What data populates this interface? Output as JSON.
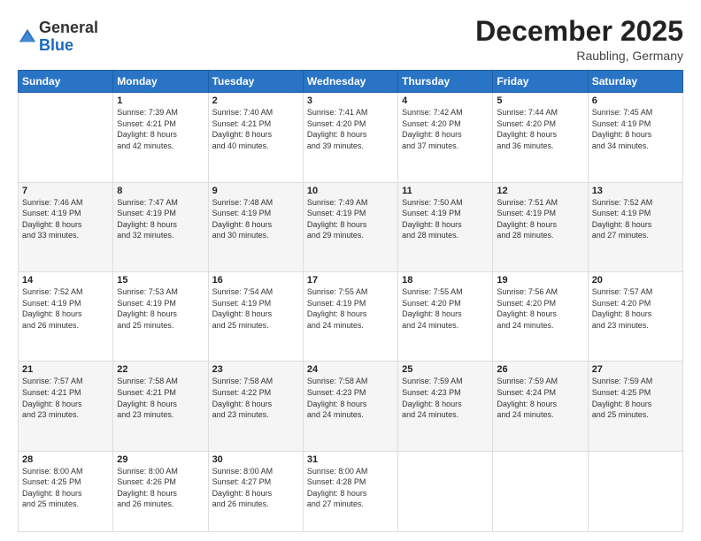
{
  "header": {
    "logo_general": "General",
    "logo_blue": "Blue",
    "month_title": "December 2025",
    "location": "Raubling, Germany"
  },
  "days_of_week": [
    "Sunday",
    "Monday",
    "Tuesday",
    "Wednesday",
    "Thursday",
    "Friday",
    "Saturday"
  ],
  "weeks": [
    [
      {
        "day": "",
        "text": ""
      },
      {
        "day": "1",
        "text": "Sunrise: 7:39 AM\nSunset: 4:21 PM\nDaylight: 8 hours\nand 42 minutes."
      },
      {
        "day": "2",
        "text": "Sunrise: 7:40 AM\nSunset: 4:21 PM\nDaylight: 8 hours\nand 40 minutes."
      },
      {
        "day": "3",
        "text": "Sunrise: 7:41 AM\nSunset: 4:20 PM\nDaylight: 8 hours\nand 39 minutes."
      },
      {
        "day": "4",
        "text": "Sunrise: 7:42 AM\nSunset: 4:20 PM\nDaylight: 8 hours\nand 37 minutes."
      },
      {
        "day": "5",
        "text": "Sunrise: 7:44 AM\nSunset: 4:20 PM\nDaylight: 8 hours\nand 36 minutes."
      },
      {
        "day": "6",
        "text": "Sunrise: 7:45 AM\nSunset: 4:19 PM\nDaylight: 8 hours\nand 34 minutes."
      }
    ],
    [
      {
        "day": "7",
        "text": "Sunrise: 7:46 AM\nSunset: 4:19 PM\nDaylight: 8 hours\nand 33 minutes."
      },
      {
        "day": "8",
        "text": "Sunrise: 7:47 AM\nSunset: 4:19 PM\nDaylight: 8 hours\nand 32 minutes."
      },
      {
        "day": "9",
        "text": "Sunrise: 7:48 AM\nSunset: 4:19 PM\nDaylight: 8 hours\nand 30 minutes."
      },
      {
        "day": "10",
        "text": "Sunrise: 7:49 AM\nSunset: 4:19 PM\nDaylight: 8 hours\nand 29 minutes."
      },
      {
        "day": "11",
        "text": "Sunrise: 7:50 AM\nSunset: 4:19 PM\nDaylight: 8 hours\nand 28 minutes."
      },
      {
        "day": "12",
        "text": "Sunrise: 7:51 AM\nSunset: 4:19 PM\nDaylight: 8 hours\nand 28 minutes."
      },
      {
        "day": "13",
        "text": "Sunrise: 7:52 AM\nSunset: 4:19 PM\nDaylight: 8 hours\nand 27 minutes."
      }
    ],
    [
      {
        "day": "14",
        "text": "Sunrise: 7:52 AM\nSunset: 4:19 PM\nDaylight: 8 hours\nand 26 minutes."
      },
      {
        "day": "15",
        "text": "Sunrise: 7:53 AM\nSunset: 4:19 PM\nDaylight: 8 hours\nand 25 minutes."
      },
      {
        "day": "16",
        "text": "Sunrise: 7:54 AM\nSunset: 4:19 PM\nDaylight: 8 hours\nand 25 minutes."
      },
      {
        "day": "17",
        "text": "Sunrise: 7:55 AM\nSunset: 4:19 PM\nDaylight: 8 hours\nand 24 minutes."
      },
      {
        "day": "18",
        "text": "Sunrise: 7:55 AM\nSunset: 4:20 PM\nDaylight: 8 hours\nand 24 minutes."
      },
      {
        "day": "19",
        "text": "Sunrise: 7:56 AM\nSunset: 4:20 PM\nDaylight: 8 hours\nand 24 minutes."
      },
      {
        "day": "20",
        "text": "Sunrise: 7:57 AM\nSunset: 4:20 PM\nDaylight: 8 hours\nand 23 minutes."
      }
    ],
    [
      {
        "day": "21",
        "text": "Sunrise: 7:57 AM\nSunset: 4:21 PM\nDaylight: 8 hours\nand 23 minutes."
      },
      {
        "day": "22",
        "text": "Sunrise: 7:58 AM\nSunset: 4:21 PM\nDaylight: 8 hours\nand 23 minutes."
      },
      {
        "day": "23",
        "text": "Sunrise: 7:58 AM\nSunset: 4:22 PM\nDaylight: 8 hours\nand 23 minutes."
      },
      {
        "day": "24",
        "text": "Sunrise: 7:58 AM\nSunset: 4:23 PM\nDaylight: 8 hours\nand 24 minutes."
      },
      {
        "day": "25",
        "text": "Sunrise: 7:59 AM\nSunset: 4:23 PM\nDaylight: 8 hours\nand 24 minutes."
      },
      {
        "day": "26",
        "text": "Sunrise: 7:59 AM\nSunset: 4:24 PM\nDaylight: 8 hours\nand 24 minutes."
      },
      {
        "day": "27",
        "text": "Sunrise: 7:59 AM\nSunset: 4:25 PM\nDaylight: 8 hours\nand 25 minutes."
      }
    ],
    [
      {
        "day": "28",
        "text": "Sunrise: 8:00 AM\nSunset: 4:25 PM\nDaylight: 8 hours\nand 25 minutes."
      },
      {
        "day": "29",
        "text": "Sunrise: 8:00 AM\nSunset: 4:26 PM\nDaylight: 8 hours\nand 26 minutes."
      },
      {
        "day": "30",
        "text": "Sunrise: 8:00 AM\nSunset: 4:27 PM\nDaylight: 8 hours\nand 26 minutes."
      },
      {
        "day": "31",
        "text": "Sunrise: 8:00 AM\nSunset: 4:28 PM\nDaylight: 8 hours\nand 27 minutes."
      },
      {
        "day": "",
        "text": ""
      },
      {
        "day": "",
        "text": ""
      },
      {
        "day": "",
        "text": ""
      }
    ]
  ]
}
